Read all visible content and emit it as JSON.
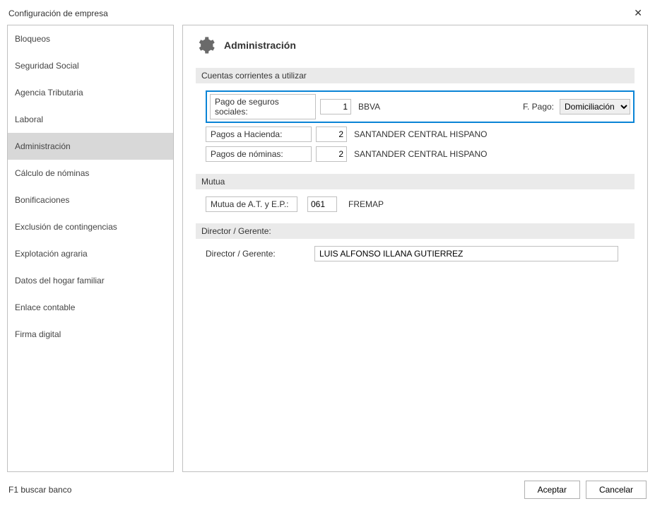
{
  "window": {
    "title": "Configuración de empresa"
  },
  "sidebar": {
    "items": [
      {
        "label": "Bloqueos"
      },
      {
        "label": "Seguridad Social"
      },
      {
        "label": "Agencia Tributaria"
      },
      {
        "label": "Laboral"
      },
      {
        "label": "Administración",
        "selected": true
      },
      {
        "label": "Cálculo de nóminas"
      },
      {
        "label": "Bonificaciones"
      },
      {
        "label": "Exclusión de contingencias"
      },
      {
        "label": "Explotación agraria"
      },
      {
        "label": "Datos del hogar familiar"
      },
      {
        "label": "Enlace contable"
      },
      {
        "label": "Firma digital"
      }
    ]
  },
  "content": {
    "title": "Administración",
    "accounts": {
      "header": "Cuentas corrientes a utilizar",
      "rows": [
        {
          "label": "Pago de seguros sociales:",
          "code": "1",
          "bank": "BBVA",
          "fp_label": "F. Pago:",
          "fp_value": "Domiciliación",
          "highlighted": true
        },
        {
          "label": "Pagos a Hacienda:",
          "code": "2",
          "bank": "SANTANDER CENTRAL HISPANO"
        },
        {
          "label": "Pagos de nóminas:",
          "code": "2",
          "bank": "SANTANDER CENTRAL HISPANO"
        }
      ]
    },
    "mutua": {
      "header": "Mutua",
      "label": "Mutua de A.T. y E.P.:",
      "code": "061",
      "name": "FREMAP"
    },
    "director": {
      "header": "Director / Gerente:",
      "label": "Director / Gerente:",
      "value": "LUIS ALFONSO ILLANA GUTIERREZ"
    }
  },
  "footer": {
    "hint": "F1 buscar banco",
    "accept": "Aceptar",
    "cancel": "Cancelar"
  }
}
